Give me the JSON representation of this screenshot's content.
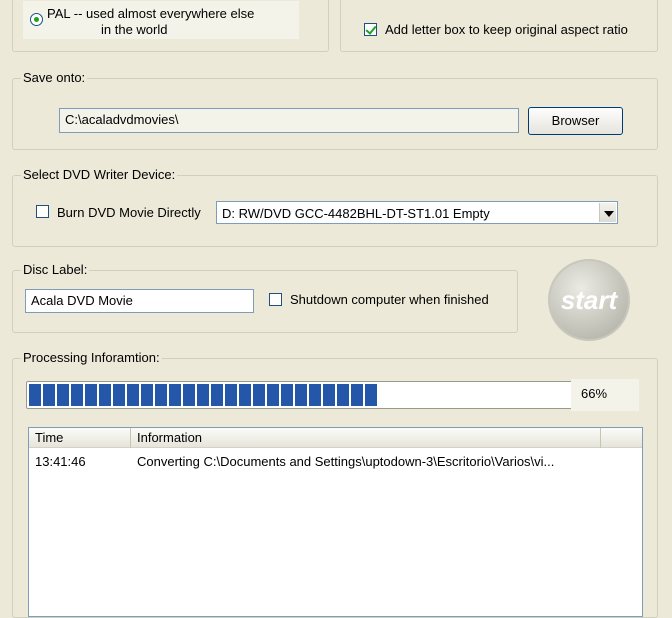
{
  "video_standard": {
    "pal_label_line1": "PAL -- used almost everywhere else",
    "pal_label_line2": "in the world"
  },
  "aspect": {
    "letterbox_label": "Add letter box to keep original aspect ratio",
    "letterbox_checked": true
  },
  "save_onto": {
    "title": "Save onto:",
    "path": "C:\\acaladvdmovies\\",
    "browse_label": "Browser"
  },
  "writer": {
    "title": "Select DVD Writer Device:",
    "burn_label": "Burn DVD Movie Directly",
    "burn_checked": false,
    "device": "D: RW/DVD GCC-4482BHL-DT-ST1.01 Empty"
  },
  "disc": {
    "title": "Disc Label:",
    "label_value": "Acala DVD Movie",
    "shutdown_label": "Shutdown computer when finished",
    "shutdown_checked": false
  },
  "start": {
    "label": "start"
  },
  "processing": {
    "title": "Processing Inforamtion:",
    "progress_percent": 66,
    "progress_text": "66%",
    "columns": [
      "Time",
      "Information"
    ],
    "rows": [
      {
        "time": "13:41:46",
        "info": "Converting C:\\Documents and Settings\\uptodown-3\\Escritorio\\Varios\\vi..."
      }
    ]
  },
  "colors": {
    "window_bg": "#ece9d8",
    "progress_fill": "#2457a8",
    "check_green": "#21a121"
  }
}
